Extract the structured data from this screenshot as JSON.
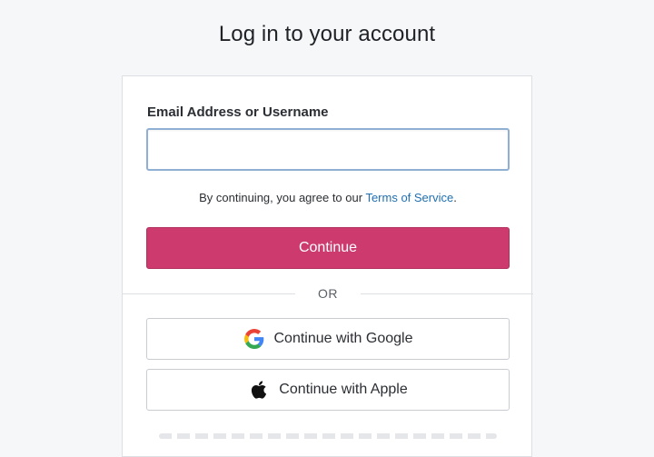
{
  "page": {
    "title": "Log in to your account"
  },
  "form": {
    "email_label": "Email Address or Username",
    "email_value": "",
    "email_placeholder": "",
    "terms_prefix": "By continuing, you agree to our ",
    "terms_link": "Terms of Service",
    "terms_suffix": ".",
    "continue_label": "Continue",
    "divider_text": "OR"
  },
  "social": {
    "google_label": "Continue with Google",
    "apple_label": "Continue with Apple",
    "google_icon": "google-g-logo",
    "apple_icon": "apple-logo"
  },
  "colors": {
    "primary": "#cc3a6e",
    "link": "#1f6fb2",
    "input_focus_border": "#8fb0d3"
  }
}
